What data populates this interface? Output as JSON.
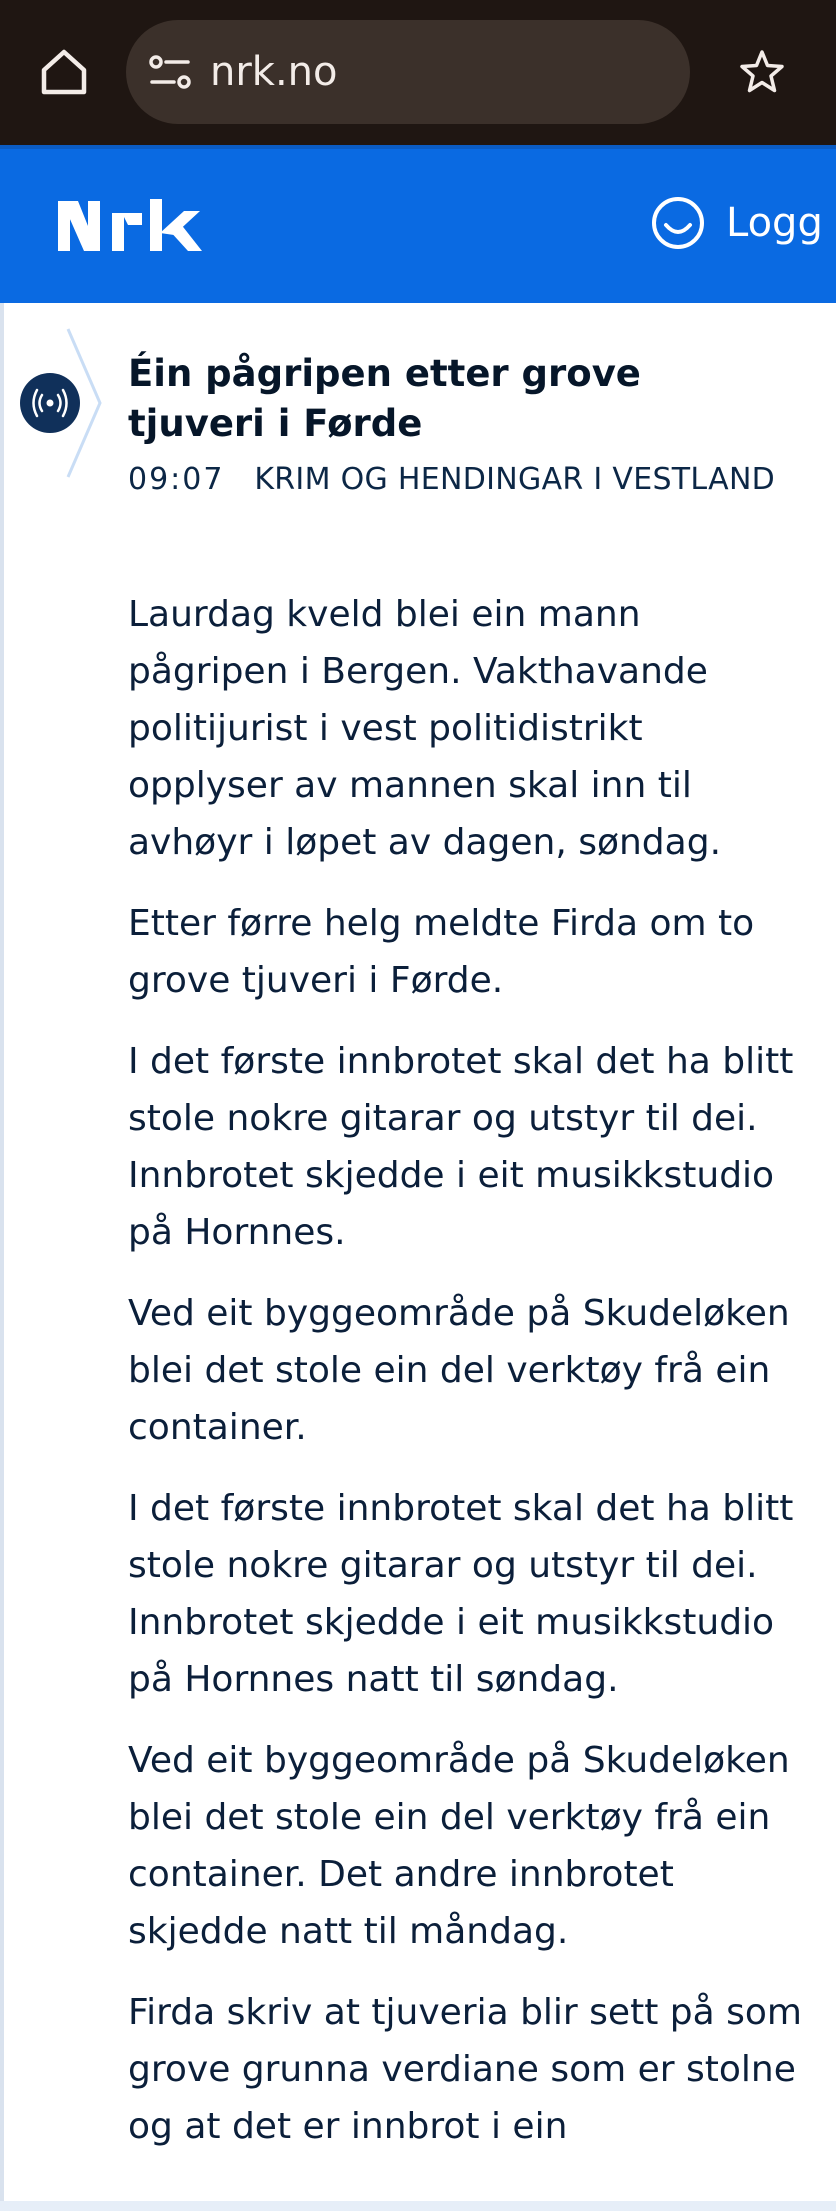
{
  "browser": {
    "url": "nrk.no",
    "icons": {
      "home": "home-icon",
      "site_settings": "tune-icon",
      "bookmark": "star-icon"
    }
  },
  "header": {
    "logo_text": "NRK",
    "login_label": "Logg på",
    "login_icon": "user-circle-icon",
    "colors": {
      "header_bg": "#0a6ae2",
      "browser_bg": "#1f1612"
    }
  },
  "entry": {
    "live_icon": "live-broadcast-icon",
    "headline": "Éin pågripen etter grove tjuveri i Førde",
    "time": "09:07",
    "category": "KRIM OG HENDINGAR I VESTLAND",
    "paragraphs": [
      "Laurdag kveld blei ein mann pågripen i Bergen. Vakthavande politijurist i vest politidistrikt opplyser av mannen skal inn til avhøyr i løpet av dagen, søndag.",
      "Etter førre helg meldte Firda om to grove tjuveri i Førde.",
      "I det første innbrotet skal det ha blitt stole nokre gitarar og utstyr til dei. Innbrotet skjedde i eit musikkstudio på Hornnes.",
      "Ved eit byggeområde på Skudeløken blei det stole ein del verktøy frå ein container.",
      "I det første innbrotet skal det ha blitt stole nokre gitarar og utstyr til dei. Innbrotet skjedde i eit musikkstudio på Hornnes natt til søndag.",
      "Ved eit byggeområde på Skudeløken blei det stole ein del verktøy frå ein container. Det andre innbrotet skjedde natt til måndag.",
      "Firda skriv at tjuveria blir sett på som grove grunna verdiane som er stolne og at det er innbrot i ein"
    ]
  }
}
